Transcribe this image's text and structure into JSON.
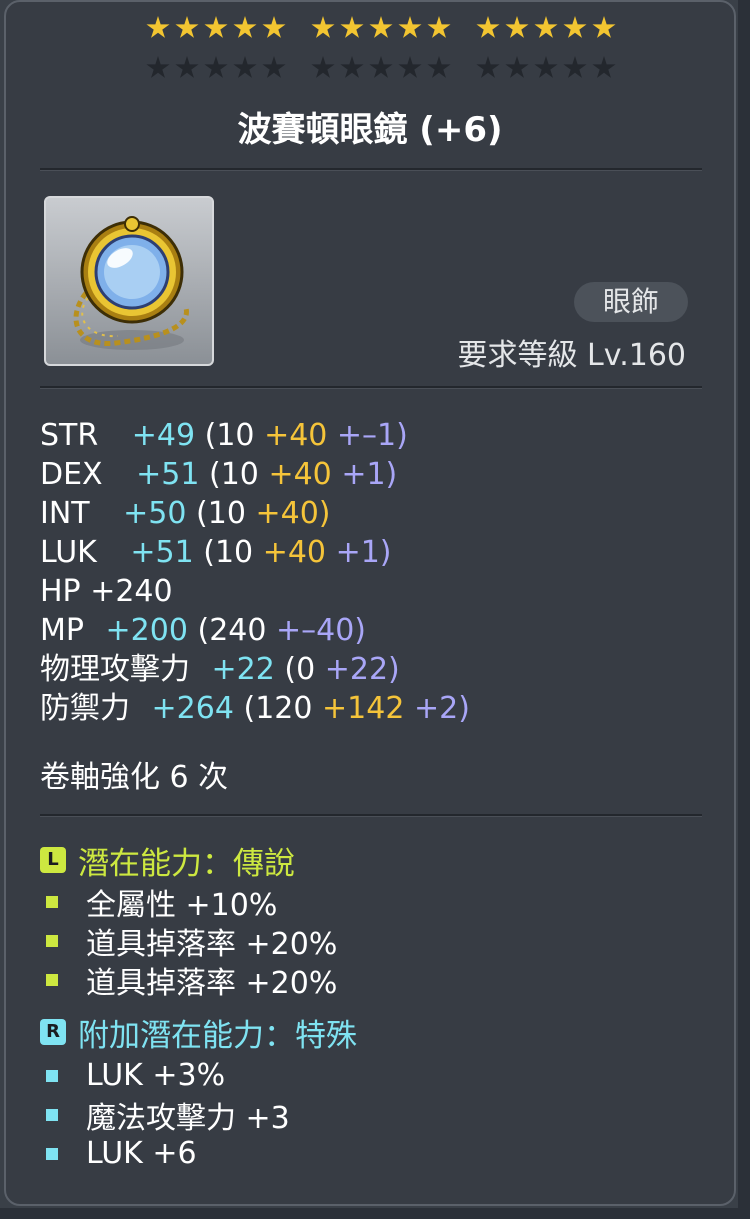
{
  "item": {
    "name": "波賽頓眼鏡 (+6)",
    "category": "眼飾",
    "required_level": "要求等級 Lv.160"
  },
  "star_force": {
    "filled": 15,
    "total": 30
  },
  "stats": [
    {
      "label": "STR",
      "total": "+49",
      "base": "(10",
      "enhance": "+40",
      "star": "+–1)"
    },
    {
      "label": "DEX",
      "total": "+51",
      "base": "(10",
      "enhance": "+40",
      "star": "+1)"
    },
    {
      "label": "INT",
      "total": "+50",
      "base": "(10",
      "enhance": "+40)",
      "star": ""
    },
    {
      "label": "LUK",
      "total": "+51",
      "base": "(10",
      "enhance": "+40",
      "star": "+1)"
    },
    {
      "label": "HP",
      "total": "+240",
      "base": "",
      "enhance": "",
      "star": ""
    },
    {
      "label": "MP",
      "total": "+200",
      "base": "(240",
      "enhance": "",
      "star": "+–40)"
    },
    {
      "label": "物理攻擊力",
      "total": "+22",
      "base": "(0",
      "enhance": "",
      "star": "+22)"
    },
    {
      "label": "防禦力",
      "total": "+264",
      "base": "(120",
      "enhance": "+142",
      "star": "+2)"
    }
  ],
  "scroll_upgrades": "卷軸強化 6 次",
  "potential": {
    "badge": "L",
    "title": "潛在能力：傳說",
    "lines": [
      "全屬性 +10%",
      "道具掉落率 +20%",
      "道具掉落率 +20%"
    ]
  },
  "additional_potential": {
    "badge": "R",
    "title": "附加潛在能力：特殊",
    "lines": [
      "LUK +3%",
      "魔法攻擊力 +3",
      "LUK +6"
    ]
  },
  "colors": {
    "total": "#7fe3f2",
    "enhance": "#f5c43a",
    "star": "#a9a6f7",
    "legendary": "#cde840",
    "special": "#7fe3f2"
  }
}
